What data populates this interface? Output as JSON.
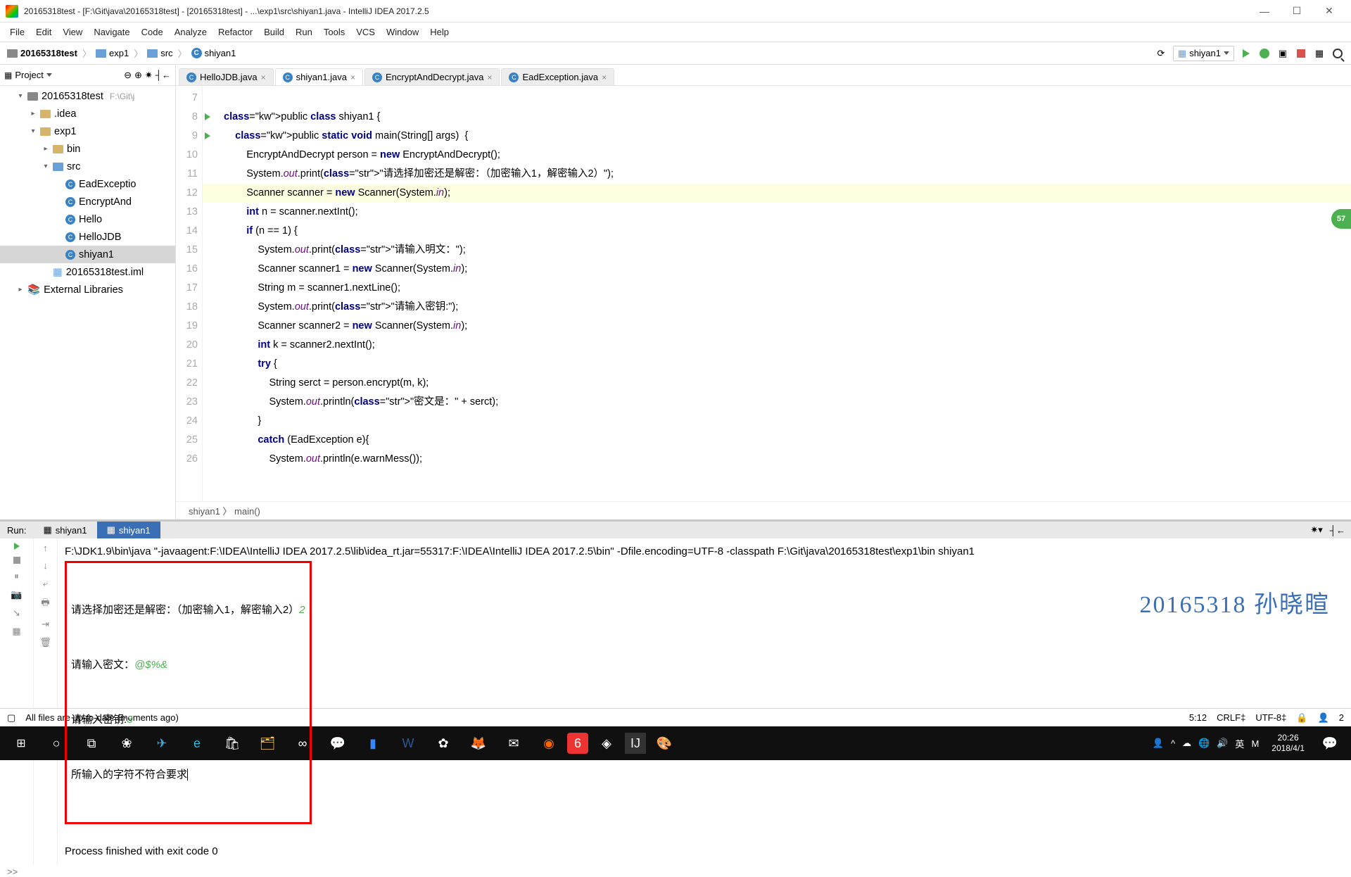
{
  "window": {
    "title": "20165318test - [F:\\Git\\java\\20165318test] - [20165318test] - ...\\exp1\\src\\shiyan1.java - IntelliJ IDEA 2017.2.5"
  },
  "menu": [
    "File",
    "Edit",
    "View",
    "Navigate",
    "Code",
    "Analyze",
    "Refactor",
    "Build",
    "Run",
    "Tools",
    "VCS",
    "Window",
    "Help"
  ],
  "breadcrumb": [
    "20165318test",
    "exp1",
    "src",
    "shiyan1"
  ],
  "run_config": "shiyan1",
  "badge": "57",
  "project": {
    "title": "Project",
    "root": "20165318test",
    "root_hint": "F:\\Git\\j",
    "nodes": [
      {
        "indent": 1,
        "arw": "▾",
        "icon": "module",
        "label": "20165318test",
        "hint": "F:\\Git\\j"
      },
      {
        "indent": 2,
        "arw": "▸",
        "icon": "folder",
        "label": ".idea"
      },
      {
        "indent": 2,
        "arw": "▾",
        "icon": "folder",
        "label": "exp1"
      },
      {
        "indent": 3,
        "arw": "▸",
        "icon": "folder",
        "label": "bin"
      },
      {
        "indent": 3,
        "arw": "▾",
        "icon": "src",
        "label": "src"
      },
      {
        "indent": 4,
        "arw": "",
        "icon": "cfile",
        "label": "EadExceptio"
      },
      {
        "indent": 4,
        "arw": "",
        "icon": "cfile",
        "label": "EncryptAnd"
      },
      {
        "indent": 4,
        "arw": "",
        "icon": "cfile",
        "label": "Hello"
      },
      {
        "indent": 4,
        "arw": "",
        "icon": "cfile",
        "label": "HelloJDB"
      },
      {
        "indent": 4,
        "arw": "",
        "icon": "cfile",
        "label": "shiyan1",
        "sel": true
      },
      {
        "indent": 3,
        "arw": "",
        "icon": "iml",
        "label": "20165318test.iml"
      },
      {
        "indent": 1,
        "arw": "▸",
        "icon": "lib",
        "label": "External Libraries"
      }
    ]
  },
  "tabs": [
    {
      "label": "HelloJDB.java",
      "active": false
    },
    {
      "label": "shiyan1.java",
      "active": true
    },
    {
      "label": "EncryptAndDecrypt.java",
      "active": false
    },
    {
      "label": "EadException.java",
      "active": false
    }
  ],
  "editor": {
    "first_line": 7,
    "lines": [
      "",
      "public class shiyan1 {",
      "    public static void main(String[] args)  {",
      "        EncryptAndDecrypt person = new EncryptAndDecrypt();",
      "        System.out.print(\"请选择加密还是解密：（加密输入1，解密输入2）\");",
      "        Scanner scanner = new Scanner(System.in);",
      "        int n = scanner.nextInt();",
      "        if (n == 1) {",
      "            System.out.print(\"请输入明文：\");",
      "            Scanner scanner1 = new Scanner(System.in);",
      "            String m = scanner1.nextLine();",
      "            System.out.print(\"请输入密钥:\");",
      "            Scanner scanner2 = new Scanner(System.in);",
      "            int k = scanner2.nextInt();",
      "            try {",
      "                String serct = person.encrypt(m, k);",
      "                System.out.println(\"密文是：\" + serct);",
      "            }",
      "            catch (EadException e){",
      "                System.out.println(e.warnMess());"
    ],
    "highlight_index": 5,
    "path": "shiyan1 〉 main()"
  },
  "run": {
    "label": "Run:",
    "tabs": [
      {
        "label": "shiyan1",
        "active": false
      },
      {
        "label": "shiyan1",
        "active": true
      }
    ],
    "cmd": "F:\\JDK1.9\\bin\\java \"-javaagent:F:\\IDEA\\IntelliJ IDEA 2017.2.5\\lib\\idea_rt.jar=55317:F:\\IDEA\\IntelliJ IDEA 2017.2.5\\bin\" -Dfile.encoding=UTF-8 -classpath F:\\Git\\java\\20165318test\\exp1\\bin shiyan1",
    "box": {
      "l1_prompt": "请选择加密还是解密：（加密输入1，解密输入2）",
      "l1_in": "2",
      "l2_prompt": "请输入密文：",
      "l2_in": "@$%&",
      "l3_prompt": "请输入密钥:",
      "l3_in": "3",
      "l4": "所输入的字符不符合要求"
    },
    "exit": "Process finished with exit code 0",
    "watermark": "20165318 孙晓暄",
    "hide": ">>"
  },
  "status": {
    "left": "All files are up-to-date (moments ago)",
    "pos": "5:12",
    "eol": "CRLF‡",
    "enc": "UTF-8‡",
    "lock": "🔒"
  },
  "taskbar": {
    "time": "20:26",
    "date": "2018/4/1",
    "ime": "英"
  }
}
